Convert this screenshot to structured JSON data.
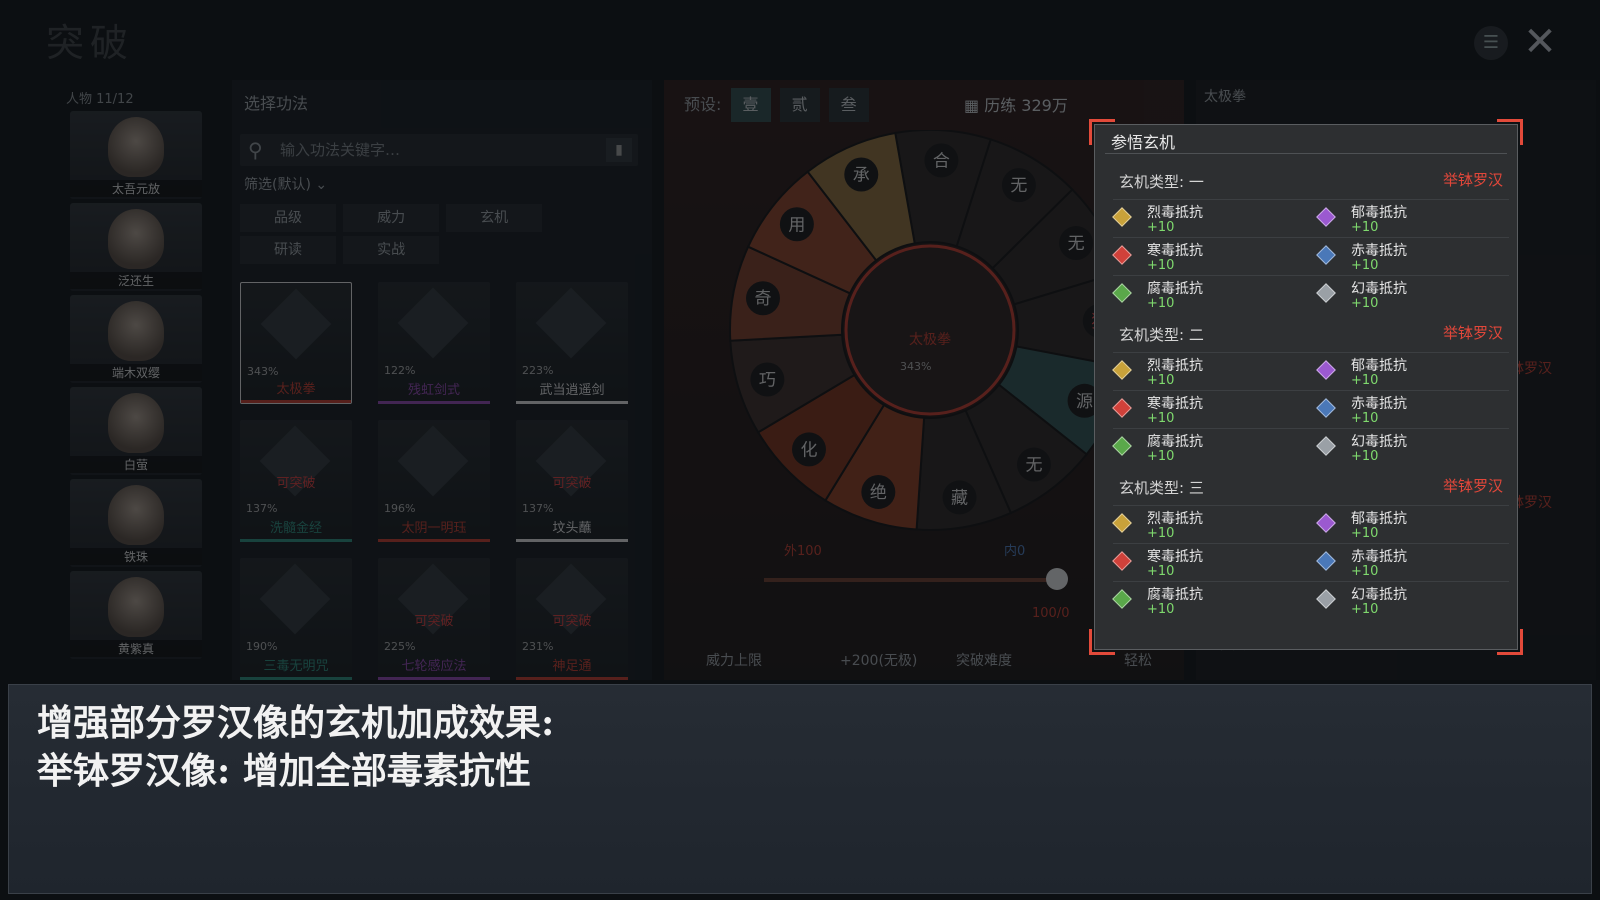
{
  "top_bar": {
    "logo_text": "突破",
    "menu_icon": "book-icon",
    "close_icon": "close-icon"
  },
  "characters": {
    "count_label": "人物 11/12",
    "list": [
      {
        "name": "太吾元放"
      },
      {
        "name": "泛还生"
      },
      {
        "name": "端木双缨"
      },
      {
        "name": "白萤"
      },
      {
        "name": "铁珠"
      },
      {
        "name": "黄紫真"
      }
    ]
  },
  "technique_panel": {
    "title": "选择功法",
    "search_placeholder": "输入功法关键字…",
    "filter_label": "筛选(默认)",
    "sort_buttons": [
      "品级",
      "威力",
      "玄机",
      "研读",
      "实战"
    ],
    "techniques": [
      {
        "name": "太极拳",
        "pct": "343%",
        "color": "#c0392b",
        "selected": true,
        "breakable": ""
      },
      {
        "name": "残虹剑式",
        "pct": "122%",
        "color": "#8e44ad",
        "selected": false,
        "breakable": ""
      },
      {
        "name": "武当逍遥剑",
        "pct": "223%",
        "color": "#d8d8d8",
        "selected": false,
        "breakable": ""
      },
      {
        "name": "洗髓金经",
        "pct": "137%",
        "color": "#2a8a7a",
        "selected": false,
        "breakable": "可突破"
      },
      {
        "name": "太阴一明珏",
        "pct": "196%",
        "color": "#c0392b",
        "selected": false,
        "breakable": ""
      },
      {
        "name": "坟头蘸",
        "pct": "137%",
        "color": "#d8d8d8",
        "selected": false,
        "breakable": "可突破"
      },
      {
        "name": "三毒无明咒",
        "pct": "190%",
        "color": "#2a8a7a",
        "selected": false,
        "breakable": ""
      },
      {
        "name": "七轮感应法",
        "pct": "225%",
        "color": "#8e44ad",
        "selected": false,
        "breakable": "可突破"
      },
      {
        "name": "神足通",
        "pct": "231%",
        "color": "#c0392b",
        "selected": false,
        "breakable": "可突破"
      }
    ]
  },
  "center": {
    "preset_label": "预设:",
    "presets": [
      "壹",
      "贰",
      "叁"
    ],
    "active_preset": 0,
    "training_label": "历练 329万",
    "wheel_center_label": "太极拳",
    "wheel_center_pct": "343%",
    "wheel_segments": [
      "合",
      "无",
      "无",
      "独",
      "源",
      "无",
      "藏",
      "绝",
      "化",
      "巧",
      "奇",
      "用",
      "承"
    ],
    "slider_left": "外100",
    "slider_right": "内0",
    "slider_value": "100/0",
    "power_cap_label": "威力上限",
    "power_cap_value": "+200(无极)",
    "breakthrough_label": "突破难度",
    "breakthrough_value": "轻松"
  },
  "right_panel": {
    "title": "太极拳",
    "hint_tag": "举钵罗汉",
    "hint_section": "玄机类型: 三"
  },
  "modal": {
    "title": "参悟玄机",
    "sections": [
      {
        "title": "玄机类型: 一",
        "tag": "举钵罗汉",
        "attrs": [
          {
            "name": "烈毒抵抗",
            "value": "+10",
            "color": "#c9a23a"
          },
          {
            "name": "郁毒抵抗",
            "value": "+10",
            "color": "#9b59d0"
          },
          {
            "name": "寒毒抵抗",
            "value": "+10",
            "color": "#d0413a"
          },
          {
            "name": "赤毒抵抗",
            "value": "+10",
            "color": "#4a78b8"
          },
          {
            "name": "腐毒抵抗",
            "value": "+10",
            "color": "#5aa84a"
          },
          {
            "name": "幻毒抵抗",
            "value": "+10",
            "color": "#9aa0a6"
          }
        ]
      },
      {
        "title": "玄机类型: 二",
        "tag": "举钵罗汉",
        "attrs": [
          {
            "name": "烈毒抵抗",
            "value": "+10",
            "color": "#c9a23a"
          },
          {
            "name": "郁毒抵抗",
            "value": "+10",
            "color": "#9b59d0"
          },
          {
            "name": "寒毒抵抗",
            "value": "+10",
            "color": "#d0413a"
          },
          {
            "name": "赤毒抵抗",
            "value": "+10",
            "color": "#4a78b8"
          },
          {
            "name": "腐毒抵抗",
            "value": "+10",
            "color": "#5aa84a"
          },
          {
            "name": "幻毒抵抗",
            "value": "+10",
            "color": "#9aa0a6"
          }
        ]
      },
      {
        "title": "玄机类型: 三",
        "tag": "举钵罗汉",
        "attrs": [
          {
            "name": "烈毒抵抗",
            "value": "+10",
            "color": "#c9a23a"
          },
          {
            "name": "郁毒抵抗",
            "value": "+10",
            "color": "#9b59d0"
          },
          {
            "name": "寒毒抵抗",
            "value": "+10",
            "color": "#d0413a"
          },
          {
            "name": "赤毒抵抗",
            "value": "+10",
            "color": "#4a78b8"
          },
          {
            "name": "腐毒抵抗",
            "value": "+10",
            "color": "#5aa84a"
          },
          {
            "name": "幻毒抵抗",
            "value": "+10",
            "color": "#9aa0a6"
          }
        ]
      }
    ]
  },
  "banner": {
    "line1": "增强部分罗汉像的玄机加成效果:",
    "line2": "举钵罗汉像: 增加全部毒素抗性"
  }
}
